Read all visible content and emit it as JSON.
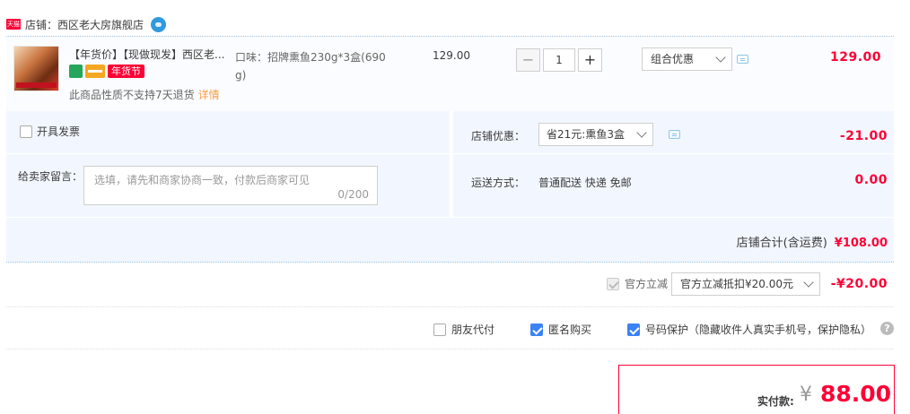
{
  "shop": {
    "badge": "天猫",
    "label": "店铺：",
    "name": "西区老大房旗舰店"
  },
  "item": {
    "title": "【年货价】【现做现发】西区老...",
    "festival_badge": "年货节",
    "return_note": "此商品性质不支持7天退货",
    "detail_link": "详情",
    "spec_line1": "口味：招牌熏鱼230g*3盒(690",
    "spec_line2": "g)",
    "unit_price": "129.00",
    "qty_minus": "−",
    "qty": "1",
    "qty_plus": "+",
    "promo": "组合优惠",
    "amount": "129.00"
  },
  "options": {
    "invoice_label": "开具发票",
    "memo_label": "给卖家留言：",
    "memo_placeholder": "选填，请先和商家协商一致，付款后商家可见",
    "memo_count": "0/200",
    "shop_discount_label": "店铺优惠：",
    "shop_discount_value": "省21元:熏鱼3盒",
    "shop_discount_amount": "-21.00",
    "shipping_label": "运送方式：",
    "shipping_value": "普通配送 快递 免邮",
    "shipping_amount": "0.00",
    "subtotal_label": "店铺合计(含运费)",
    "subtotal_value": "¥108.00"
  },
  "official": {
    "label": "官方立减",
    "select": "官方立减抵扣¥20.00元",
    "amount": "-¥20.00"
  },
  "privacy": {
    "friend_pay": "朋友代付",
    "anonymous": "匿名购买",
    "number_protect": "号码保护（隐藏收件人真实手机号，保护隐私）",
    "help": "?"
  },
  "pay": {
    "label": "实付款:",
    "currency": "¥",
    "amount": "88.00"
  },
  "colors": {
    "accent": "#ff0036",
    "panel": "#f2f7ff",
    "checkbox": "#3b82f6"
  }
}
